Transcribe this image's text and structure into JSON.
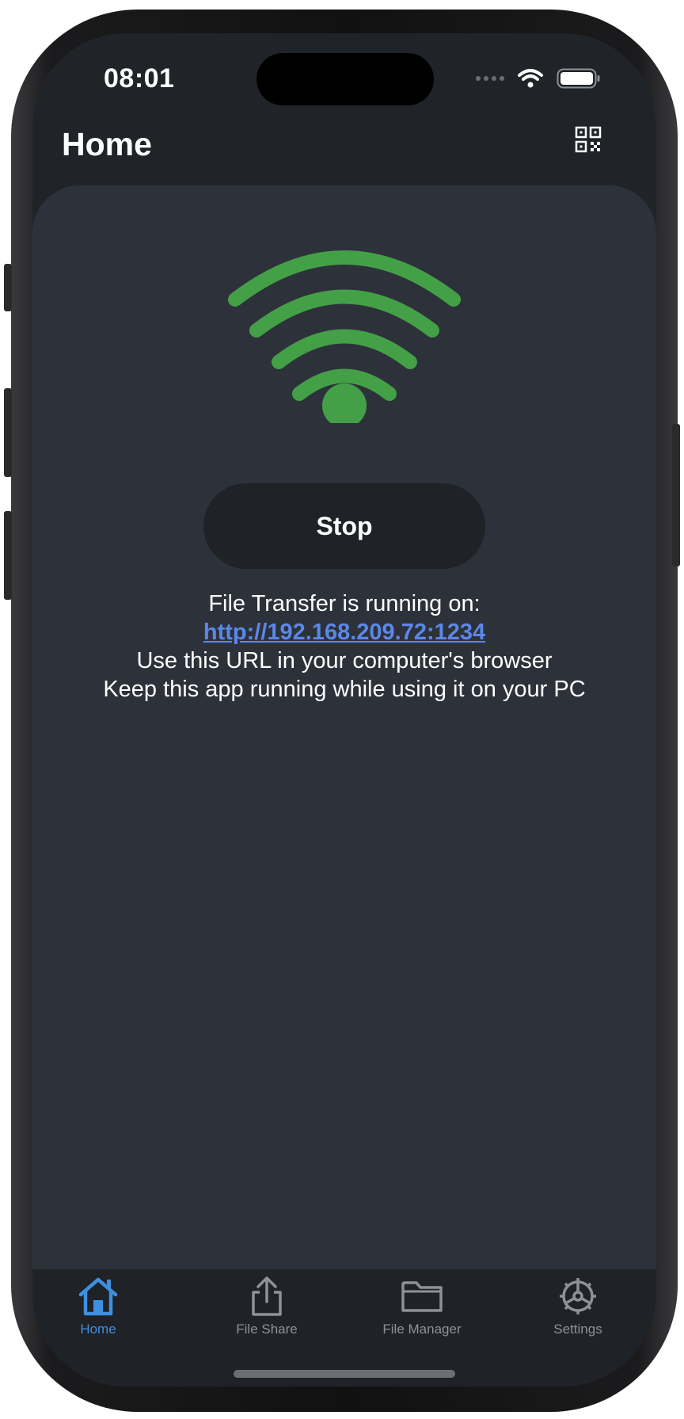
{
  "status_bar": {
    "time": "08:01",
    "icons": [
      "cellular-signal-icon",
      "wifi-icon",
      "battery-icon"
    ]
  },
  "nav": {
    "title": "Home",
    "qr_icon": "qr-code-icon"
  },
  "main": {
    "status_icon": "wifi-icon",
    "status_color": "#43a047",
    "stop_label": "Stop",
    "running_text": "File Transfer is running on:",
    "url": "http://192.168.209.72:1234",
    "url_color": "#5b87e8",
    "hint_browser": "Use this URL in your computer's browser",
    "hint_keep": "Keep this app running while using it on your PC"
  },
  "tab_bar": {
    "active_color": "#3f8fe0",
    "inactive_color": "#8e9196",
    "items": [
      {
        "label": "Home",
        "icon": "home-icon",
        "active": true
      },
      {
        "label": "File Share",
        "icon": "share-icon",
        "active": false
      },
      {
        "label": "File Manager",
        "icon": "folder-icon",
        "active": false
      },
      {
        "label": "Settings",
        "icon": "gear-icon",
        "active": false
      }
    ]
  }
}
